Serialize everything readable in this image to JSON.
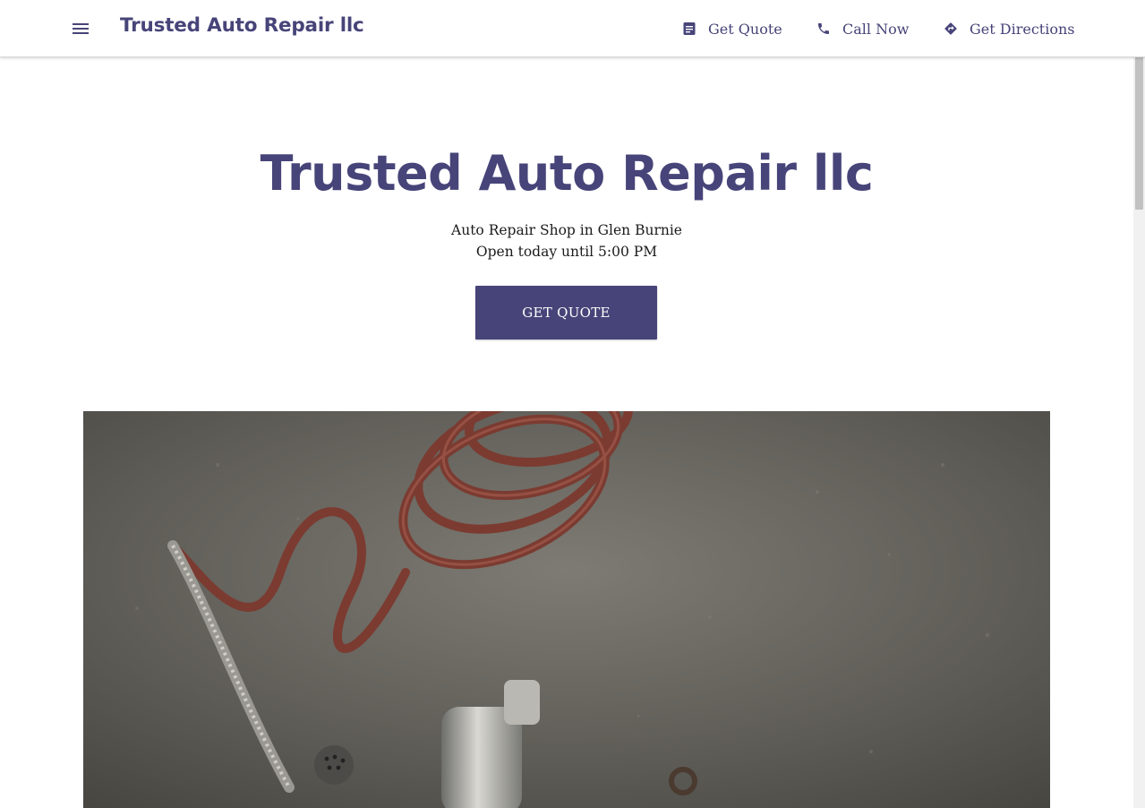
{
  "header": {
    "brand": "Trusted Auto Repair llc",
    "actions": [
      {
        "label": "Get Quote",
        "icon": "document-icon"
      },
      {
        "label": "Call Now",
        "icon": "phone-icon"
      },
      {
        "label": "Get Directions",
        "icon": "directions-icon"
      }
    ]
  },
  "hero": {
    "title": "Trusted Auto Repair llc",
    "subtitle": "Auto Repair Shop in Glen Burnie",
    "hours": "Open today until 5:00 PM",
    "cta_label": "GET QUOTE"
  },
  "colors": {
    "brand": "#474479",
    "button_text": "#ffffff"
  }
}
